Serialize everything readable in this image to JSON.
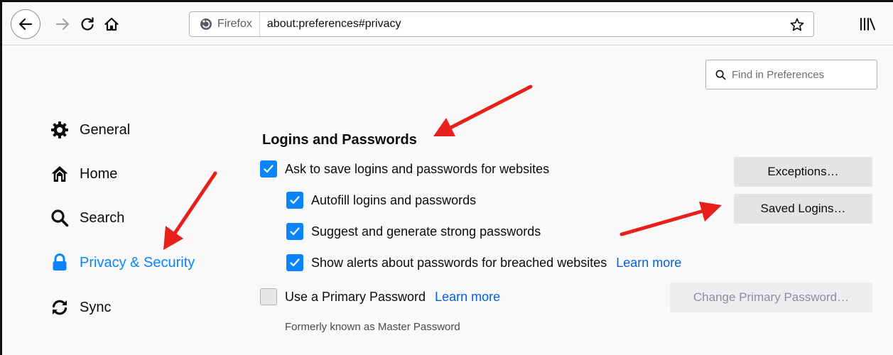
{
  "toolbar": {
    "identity_label": "Firefox",
    "url": "about:preferences#privacy"
  },
  "search": {
    "placeholder": "Find in Preferences"
  },
  "sidebar": {
    "items": [
      {
        "label": "General",
        "icon": "gear-icon"
      },
      {
        "label": "Home",
        "icon": "home-icon"
      },
      {
        "label": "Search",
        "icon": "search-icon"
      },
      {
        "label": "Privacy & Security",
        "icon": "lock-icon",
        "selected": true
      },
      {
        "label": "Sync",
        "icon": "sync-icon"
      }
    ]
  },
  "logins": {
    "title": "Logins and Passwords",
    "ask_to_save": {
      "label": "Ask to save logins and passwords for websites",
      "checked": true
    },
    "autofill": {
      "label": "Autofill logins and passwords",
      "checked": true
    },
    "suggest": {
      "label": "Suggest and generate strong passwords",
      "checked": true
    },
    "breach_alerts": {
      "label": "Show alerts about passwords for breached websites",
      "checked": true,
      "link": "Learn more"
    },
    "primary_password": {
      "label": "Use a Primary Password",
      "checked": false,
      "link": "Learn more"
    },
    "note": "Formerly known as Master Password",
    "exceptions_button": "Exceptions…",
    "saved_logins_button": "Saved Logins…",
    "change_primary_button": "Change Primary Password…"
  },
  "colors": {
    "accent": "#0a84ff",
    "link": "#0060df",
    "annotation_arrow": "#e8201c"
  }
}
